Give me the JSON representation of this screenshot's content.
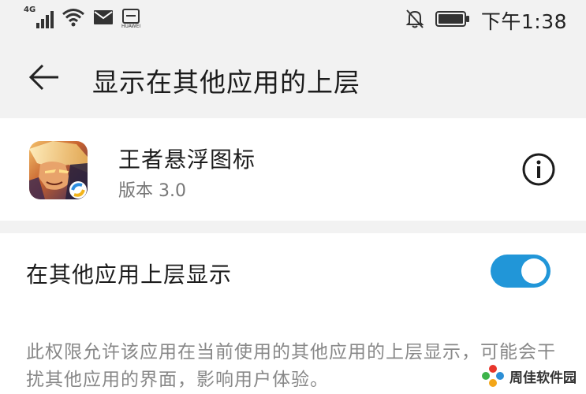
{
  "status_bar": {
    "network_type": "4G",
    "carrier_label": "HUAWEI",
    "time": "下午1:38",
    "icons": [
      "signal-icon",
      "wifi-icon",
      "mail-icon",
      "carrier-icon",
      "bell-off-icon",
      "battery-icon"
    ]
  },
  "header": {
    "title": "显示在其他应用的上层",
    "back_icon": "arrow-left-icon"
  },
  "app": {
    "name": "王者悬浮图标",
    "version": "版本 3.0",
    "info_icon": "info-icon"
  },
  "setting": {
    "label": "在其他应用上层显示",
    "enabled": true,
    "description": "此权限允许该应用在当前使用的其他应用的上层显示，可能会干扰其他应用的界面，影响用户体验。"
  },
  "watermark": {
    "text": "周佳软件园"
  },
  "colors": {
    "background": "#f2f2f2",
    "card": "#ffffff",
    "accent": "#2196d8",
    "primary_text": "#1c1c1c",
    "secondary_text": "#888888"
  }
}
